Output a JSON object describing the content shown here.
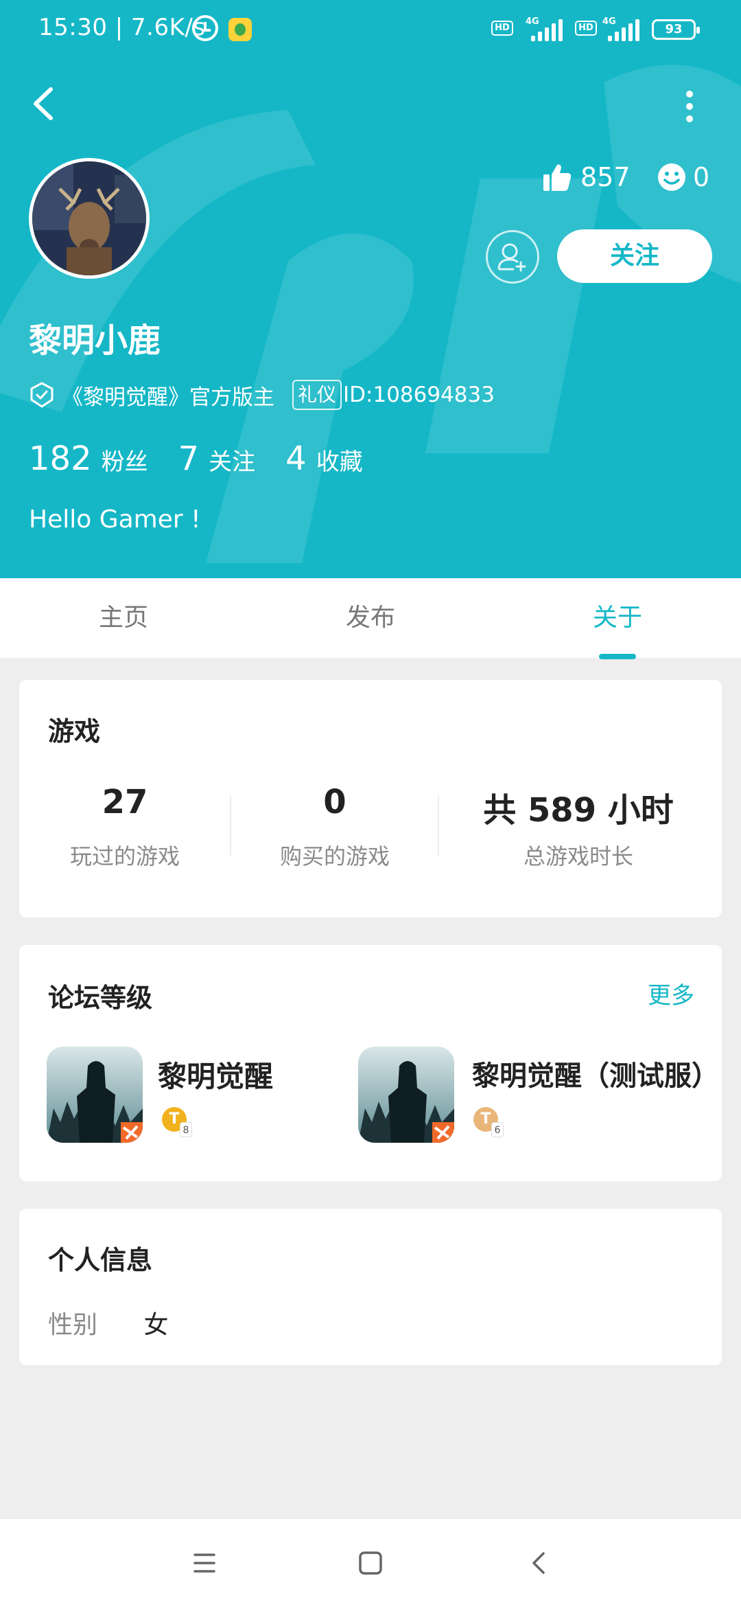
{
  "status_bar": {
    "time": "15:30 | 7.6K/s",
    "hd1": "HD",
    "net1": "4G",
    "hd2": "HD",
    "net2": "4G",
    "battery": "93"
  },
  "profile": {
    "likes": "857",
    "smiles": "0",
    "follow_label": "关注",
    "username": "黎明小鹿",
    "title": "《黎明觉醒》官方版主",
    "tag": "礼仪",
    "user_id": "ID:108694833",
    "stats": [
      {
        "value": "182",
        "label": "粉丝"
      },
      {
        "value": "7",
        "label": "关注"
      },
      {
        "value": "4",
        "label": "收藏"
      }
    ],
    "bio": "Hello Gamer !"
  },
  "tabs": [
    {
      "label": "主页"
    },
    {
      "label": "发布"
    },
    {
      "label": "关于"
    }
  ],
  "active_tab": "关于",
  "games_card": {
    "title": "游戏",
    "stats": [
      {
        "value": "27",
        "label": "玩过的游戏"
      },
      {
        "value": "0",
        "label": "购买的游戏"
      },
      {
        "value": "共 589 小时",
        "label": "总游戏时长"
      }
    ]
  },
  "forum_card": {
    "title": "论坛等级",
    "more_label": "更多",
    "games": [
      {
        "name": "黎明觉醒",
        "level": "8",
        "badge_color": "#f2b21e"
      },
      {
        "name": "黎明觉醒（测试服）",
        "level": "6",
        "badge_color": "#e9b67a"
      }
    ]
  },
  "info_card": {
    "title": "个人信息",
    "gender_label": "性别",
    "gender_value": "女"
  },
  "colors": {
    "accent": "#15b7c7",
    "background": "#eeeeee"
  },
  "icons": [
    "back-arrow-icon",
    "more-vertical-icon",
    "thumbs-up-icon",
    "smiley-icon",
    "add-friend-icon",
    "verified-shield-icon",
    "menu-icon",
    "home-square-icon",
    "nav-back-icon"
  ]
}
